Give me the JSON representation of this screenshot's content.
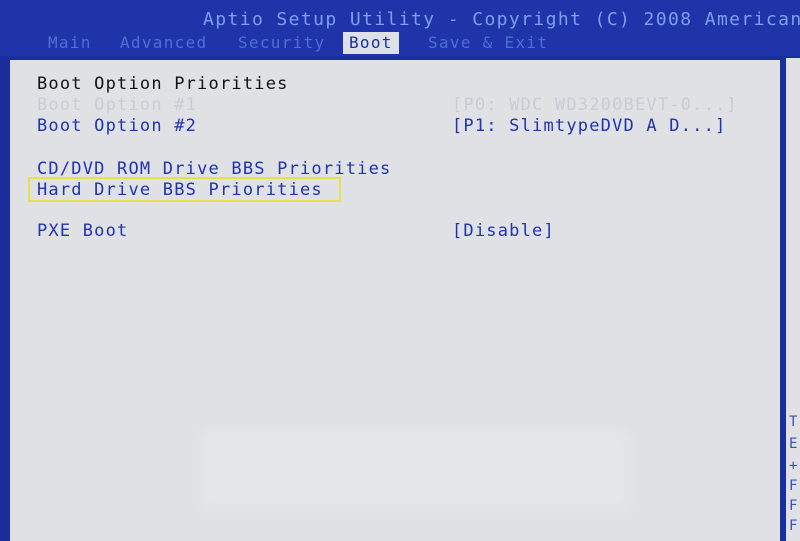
{
  "app": {
    "title": "Aptio Setup Utility - Copyright (C) 2008 American"
  },
  "tabs": [
    {
      "label": "Main",
      "active": false
    },
    {
      "label": "Advanced",
      "active": false
    },
    {
      "label": "Security",
      "active": false
    },
    {
      "label": "Boot",
      "active": true
    },
    {
      "label": "Save & Exit",
      "active": false
    }
  ],
  "boot": {
    "heading": "Boot Option Priorities",
    "option1_label": "Boot Option #1",
    "option1_value": "[P0: WDC WD3200BEVT-0...]",
    "option2_label": "Boot Option #2",
    "option2_value": "[P1: SlimtypeDVD A  D...]",
    "cdrom_priorities": "CD/DVD ROM Drive BBS Priorities",
    "hdd_priorities": "Hard Drive BBS Priorities",
    "pxe_label": "PXE Boot",
    "pxe_value": "[Disable]"
  },
  "side_help": [
    "T",
    "E",
    "+",
    "F",
    "F",
    "F"
  ],
  "colors": {
    "background": "#1a2e9e",
    "panel": "#dfe1e5",
    "selection_outline": "#e6e04a"
  }
}
